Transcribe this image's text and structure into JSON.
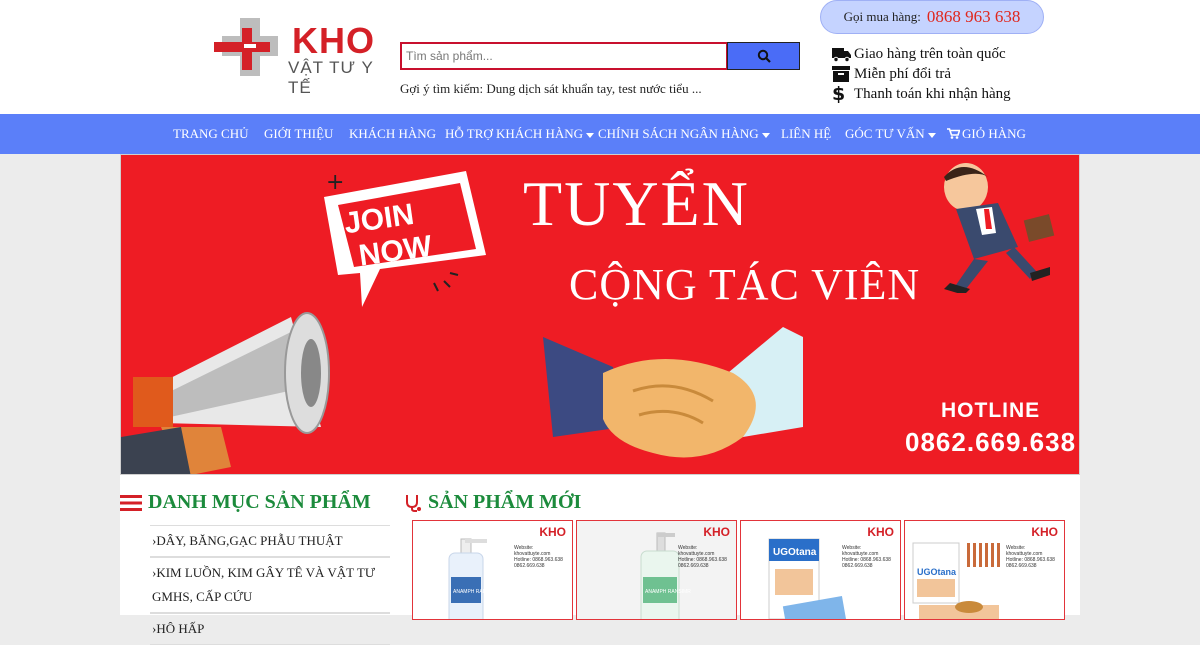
{
  "brand": {
    "name": "KHO",
    "tagline": "VẬT TƯ Y TẾ"
  },
  "search": {
    "placeholder": "Tìm sản phẩm...",
    "suggestion": "Gợi ý tìm kiếm: Dung dịch sát khuẩn tay, test nước tiểu ..."
  },
  "hotline": {
    "label": "Gọi mua hàng:",
    "number": "0868 963 638"
  },
  "perks": [
    {
      "icon": "truck-icon",
      "text": "Giao hàng trên toàn quốc"
    },
    {
      "icon": "box-icon",
      "text": "Miễn phí đổi trả"
    },
    {
      "icon": "dollar-icon",
      "text": "Thanh toán khi nhận hàng"
    }
  ],
  "nav": [
    {
      "label": "TRANG CHỦ",
      "dropdown": false
    },
    {
      "label": "GIỚI THIỆU",
      "dropdown": false
    },
    {
      "label": "KHÁCH HÀNG",
      "dropdown": false
    },
    {
      "label": "HỖ TRỢ KHÁCH HÀNG",
      "dropdown": true
    },
    {
      "label": "CHÍNH SÁCH NGÂN HÀNG",
      "dropdown": true
    },
    {
      "label": "LIÊN HỆ",
      "dropdown": false
    },
    {
      "label": "GÓC TƯ VẤN",
      "dropdown": true
    },
    {
      "label": "GIỎ HÀNG",
      "dropdown": false,
      "icon": "cart-icon"
    }
  ],
  "banner": {
    "badge": "JOIN NOW",
    "title": "TUYỂN",
    "subtitle": "CỘNG TÁC VIÊN",
    "hotline_label": "HOTLINE",
    "hotline_number": "0862.669.638"
  },
  "categories": {
    "title": "DANH MỤC SẢN PHẨM",
    "items": [
      "DÂY, BĂNG,GẠC PHẪU THUẬT",
      "KIM LUỒN, KIM GÂY TÊ VÀ VẬT TƯ GMHS, CẤP CỨU",
      "HÔ HẤP"
    ]
  },
  "new_products": {
    "title": "SẢN PHẨM MỚI",
    "watermark": {
      "brand": "KHO",
      "website": "Website: khovattuyte.com",
      "hotline": "Hotline: 0868.963.638",
      "hotline2": "0862.669.638"
    },
    "products": [
      {
        "label": "ANAMPH RANSIMR"
      },
      {
        "label": "ANAMPH RANSIMR"
      },
      {
        "label": "UGOtana"
      },
      {
        "label": "UGOtana"
      }
    ]
  },
  "colors": {
    "brand_red": "#d42027",
    "nav_blue": "#5b7ff9",
    "banner_red": "#ee1c24",
    "section_green": "#1c8b3c",
    "hotline_pill": "#c5d3ff"
  }
}
